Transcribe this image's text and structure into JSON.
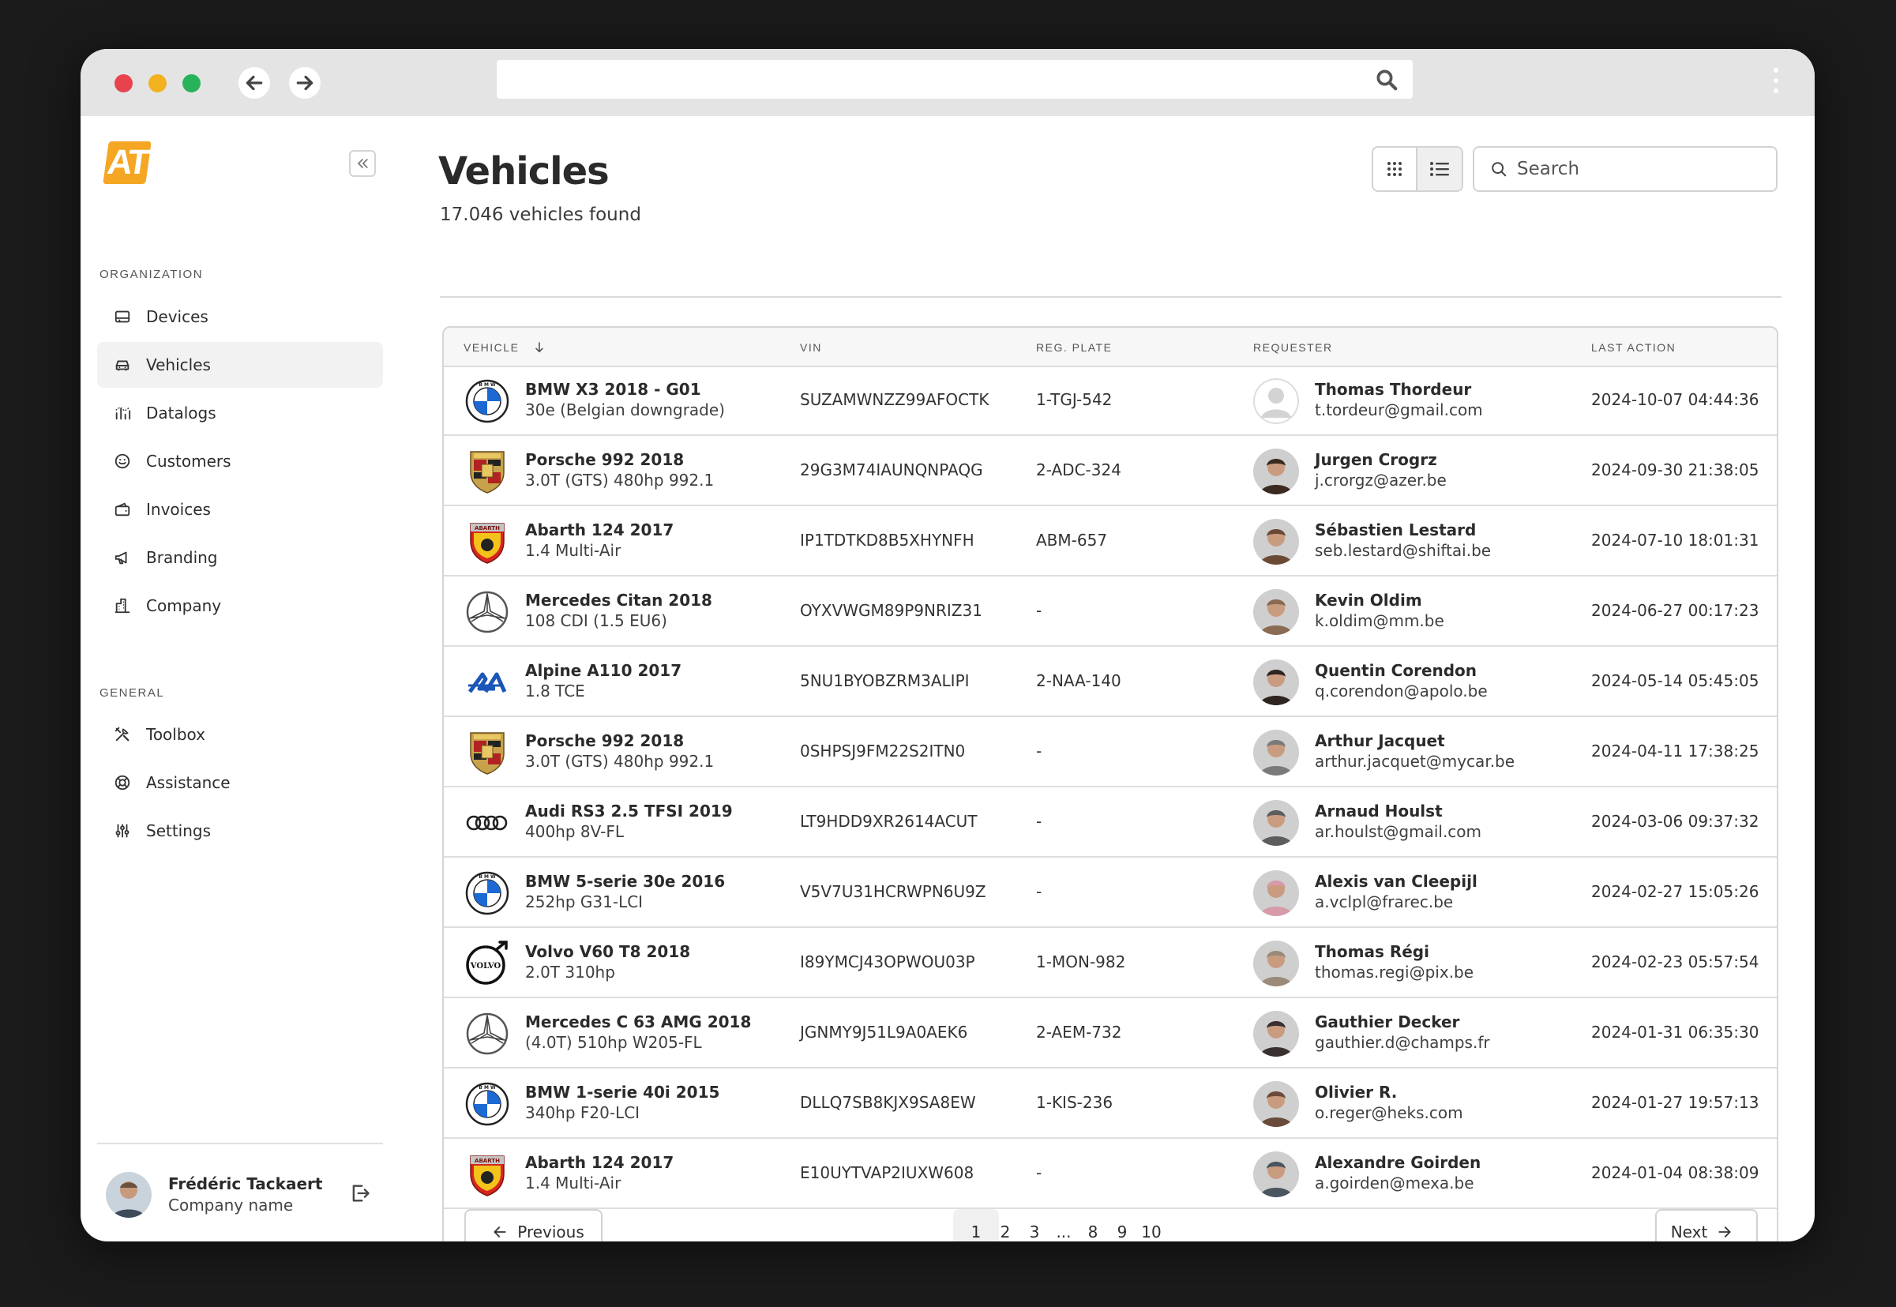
{
  "browser": {
    "url": ""
  },
  "sidebar": {
    "logo_text": "AT",
    "org_label": "ORGANIZATION",
    "org_items": [
      {
        "label": "Devices",
        "icon": "device-icon"
      },
      {
        "label": "Vehicles",
        "icon": "car-icon",
        "active": true
      },
      {
        "label": "Datalogs",
        "icon": "chart-icon"
      },
      {
        "label": "Customers",
        "icon": "smile-icon"
      },
      {
        "label": "Invoices",
        "icon": "wallet-icon"
      },
      {
        "label": "Branding",
        "icon": "megaphone-icon"
      },
      {
        "label": "Company",
        "icon": "building-icon"
      }
    ],
    "general_label": "GENERAL",
    "general_items": [
      {
        "label": "Toolbox",
        "icon": "tools-icon"
      },
      {
        "label": "Assistance",
        "icon": "lifebuoy-icon"
      },
      {
        "label": "Settings",
        "icon": "sliders-icon"
      }
    ],
    "user": {
      "name": "Frédéric Tackaert",
      "company": "Company name"
    }
  },
  "main": {
    "title": "Vehicles",
    "subtitle": "17.046 vehicles found",
    "search_placeholder": "Search",
    "columns": {
      "vehicle": "VEHICLE",
      "vin": "VIN",
      "plate": "REG. PLATE",
      "requester": "REQUESTER",
      "last_action": "LAST ACTION"
    },
    "rows": [
      {
        "brand": "bmw",
        "name": "BMW X3 2018 - G01",
        "sub": "30e (Belgian downgrade)",
        "vin": "SUZAMWNZZ99AFOCTK",
        "plate": "1-TGJ-542",
        "req_name": "Thomas Thordeur",
        "req_email": "t.tordeur@gmail.com",
        "avatar": "placeholder",
        "last": "2024-10-07 04:44:36"
      },
      {
        "brand": "porsche",
        "name": "Porsche 992 2018",
        "sub": "3.0T (GTS) 480hp 992.1",
        "vin": "29G3M74IAUNQNPAQG",
        "plate": "2-ADC-324",
        "req_name": "Jurgen Crogrz",
        "req_email": "j.crorgz@azer.be",
        "avatar": "#3b2a20",
        "last": "2024-09-30 21:38:05"
      },
      {
        "brand": "abarth",
        "name": "Abarth 124 2017",
        "sub": "1.4 Multi-Air",
        "vin": "IP1TDTKD8B5XHYNFH",
        "plate": "ABM-657",
        "req_name": "Sébastien Lestard",
        "req_email": "seb.lestard@shiftai.be",
        "avatar": "#6b4a35",
        "last": "2024-07-10 18:01:31"
      },
      {
        "brand": "mercedes",
        "name": "Mercedes Citan 2018",
        "sub": "108 CDI (1.5 EU6)",
        "vin": "OYXVWGM89P9NRIZ31",
        "plate": "-",
        "req_name": "Kevin Oldim",
        "req_email": "k.oldim@mm.be",
        "avatar": "#8a6a52",
        "last": "2024-06-27 00:17:23"
      },
      {
        "brand": "alpine",
        "name": "Alpine A110 2017",
        "sub": "1.8 TCE",
        "vin": "5NU1BYOBZRM3ALIPI",
        "plate": "2-NAA-140",
        "req_name": "Quentin Corendon",
        "req_email": "q.corendon@apolo.be",
        "avatar": "#2e2420",
        "last": "2024-05-14 05:45:05"
      },
      {
        "brand": "porsche",
        "name": "Porsche 992 2018",
        "sub": "3.0T (GTS) 480hp 992.1",
        "vin": "0SHPSJ9FM22S2ITN0",
        "plate": "-",
        "req_name": "Arthur Jacquet",
        "req_email": "arthur.jacquet@mycar.be",
        "avatar": "#7a7a7a",
        "last": "2024-04-11 17:38:25"
      },
      {
        "brand": "audi",
        "name": "Audi RS3 2.5 TFSI 2019",
        "sub": "400hp 8V-FL",
        "vin": "LT9HDD9XR2614ACUT",
        "plate": "-",
        "req_name": "Arnaud Houlst",
        "req_email": "ar.houlst@gmail.com",
        "avatar": "#5d5d5d",
        "last": "2024-03-06 09:37:32"
      },
      {
        "brand": "bmw",
        "name": "BMW 5-serie 30e 2016",
        "sub": "252hp G31-LCI",
        "vin": "V5V7U31HCRWPN6U9Z",
        "plate": "-",
        "req_name": "Alexis van Cleepijl",
        "req_email": "a.vclpl@frarec.be",
        "avatar": "#d69aa8",
        "last": "2024-02-27 15:05:26"
      },
      {
        "brand": "volvo",
        "name": "Volvo V60 T8 2018",
        "sub": "2.0T 310hp",
        "vin": "I89YMCJ43OPWOU03P",
        "plate": "1-MON-982",
        "req_name": "Thomas Régi",
        "req_email": "thomas.regi@pix.be",
        "avatar": "#9a8a7a",
        "last": "2024-02-23 05:57:54"
      },
      {
        "brand": "mercedes",
        "name": "Mercedes C 63 AMG 2018",
        "sub": "(4.0T) 510hp W205-FL",
        "vin": "JGNMY9J51L9A0AEK6",
        "plate": "2-AEM-732",
        "req_name": "Gauthier Decker",
        "req_email": "gauthier.d@champs.fr",
        "avatar": "#3a3030",
        "last": "2024-01-31 06:35:30"
      },
      {
        "brand": "bmw",
        "name": "BMW 1-serie 40i 2015",
        "sub": "340hp F20-LCI",
        "vin": "DLLQ7SB8KJX9SA8EW",
        "plate": "1-KIS-236",
        "req_name": "Olivier R.",
        "req_email": "o.reger@heks.com",
        "avatar": "#6a4a3a",
        "last": "2024-01-27 19:57:13"
      },
      {
        "brand": "abarth",
        "name": "Abarth 124 2017",
        "sub": "1.4 Multi-Air",
        "vin": "E10UYTVAP2IUXW608",
        "plate": "-",
        "req_name": "Alexandre Goirden",
        "req_email": "a.goirden@mexa.be",
        "avatar": "#4a5560",
        "last": "2024-01-04 08:38:09"
      }
    ],
    "pagination": {
      "prev_label": "Previous",
      "next_label": "Next",
      "pages": [
        "1",
        "2",
        "3",
        "...",
        "8",
        "9",
        "10"
      ],
      "current": "1"
    }
  },
  "colors": {
    "accent": "#f5a623",
    "chrome_red": "#e8424f",
    "chrome_yellow": "#f2b11e",
    "chrome_green": "#28b35b"
  }
}
